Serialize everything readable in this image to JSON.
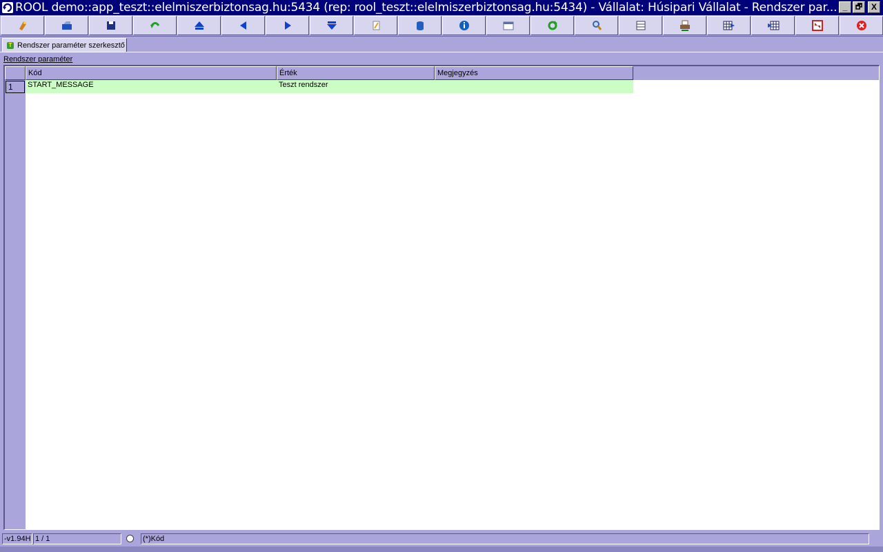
{
  "window": {
    "title": "ROOL demo::app_teszt::elelmiszerbiztonsag.hu:5434 (rep: rool_teszt::elelmiszerbiztonsag.hu:5434) - Vállalat: Húsipari Vállalat - Rendszer par...",
    "minimize": "_",
    "restore": "🗗",
    "close": "X"
  },
  "toolbar": {
    "buttons": [
      {
        "name": "new-icon",
        "color": "#d08020"
      },
      {
        "name": "open-icon",
        "color": "#2050c0"
      },
      {
        "name": "save-icon",
        "color": "#203080"
      },
      {
        "name": "undo-icon",
        "color": "#20a020"
      },
      {
        "name": "first-icon",
        "color": "#1040d0"
      },
      {
        "name": "prev-icon",
        "color": "#1040d0"
      },
      {
        "name": "next-icon",
        "color": "#1040d0"
      },
      {
        "name": "last-icon",
        "color": "#1040d0"
      },
      {
        "name": "edit-icon",
        "color": "#e0a020"
      },
      {
        "name": "database-icon",
        "color": "#2060c0"
      },
      {
        "name": "info-icon",
        "color": "#1060c0"
      },
      {
        "name": "layout-icon",
        "color": "#6070a0"
      },
      {
        "name": "refresh-icon",
        "color": "#20a020"
      },
      {
        "name": "search-icon",
        "color": "#c08020"
      },
      {
        "name": "columns-icon",
        "color": "#404060"
      },
      {
        "name": "print-icon",
        "color": "#806040"
      },
      {
        "name": "grid-export-icon",
        "color": "#2050c0"
      },
      {
        "name": "grid-import-icon",
        "color": "#2050c0"
      },
      {
        "name": "fullscreen-icon",
        "color": "#d02020"
      },
      {
        "name": "exit-icon",
        "color": "#e02020"
      }
    ]
  },
  "tab": {
    "label": "Rendszer paraméter szerkesztő",
    "icon": "T"
  },
  "section_label": "Rendszer paraméter",
  "grid": {
    "columns": [
      "Kód",
      "Érték",
      "Megjegyzés"
    ],
    "rows": [
      {
        "num": "1",
        "kod": "START_MESSAGE",
        "ertek": "Teszt rendszer",
        "megjegyzes": ""
      }
    ]
  },
  "status": {
    "version": "-v1.94H",
    "position": "1 / 1",
    "sort": "(*)Kód"
  }
}
